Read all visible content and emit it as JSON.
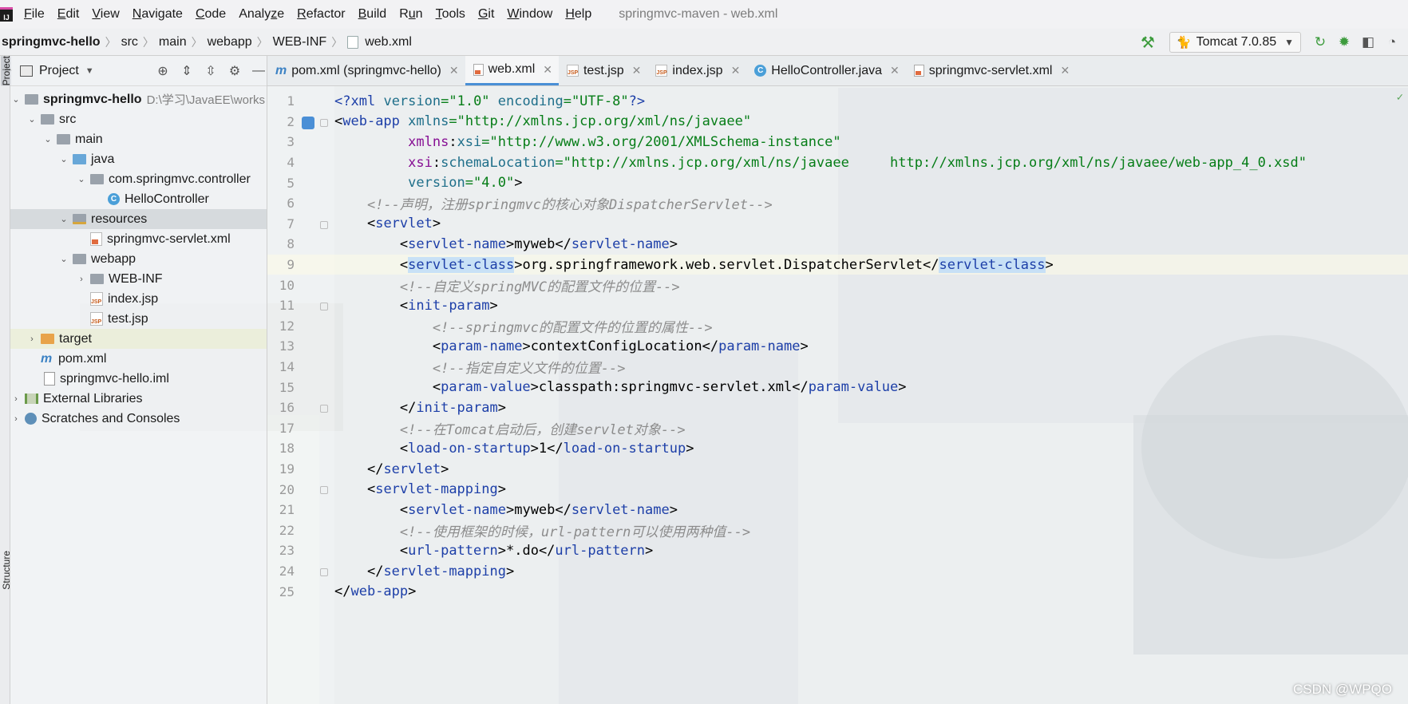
{
  "app": {
    "logo": "IJ"
  },
  "menu": [
    {
      "pre": "",
      "ul": "F",
      "post": "ile"
    },
    {
      "pre": "",
      "ul": "E",
      "post": "dit"
    },
    {
      "pre": "",
      "ul": "V",
      "post": "iew"
    },
    {
      "pre": "",
      "ul": "N",
      "post": "avigate"
    },
    {
      "pre": "",
      "ul": "C",
      "post": "ode"
    },
    {
      "pre": "Analy",
      "ul": "z",
      "post": "e"
    },
    {
      "pre": "",
      "ul": "R",
      "post": "efactor"
    },
    {
      "pre": "",
      "ul": "B",
      "post": "uild"
    },
    {
      "pre": "R",
      "ul": "u",
      "post": "n"
    },
    {
      "pre": "",
      "ul": "T",
      "post": "ools"
    },
    {
      "pre": "",
      "ul": "G",
      "post": "it"
    },
    {
      "pre": "",
      "ul": "W",
      "post": "indow"
    },
    {
      "pre": "",
      "ul": "H",
      "post": "elp"
    }
  ],
  "window_title": "springmvc-maven - web.xml",
  "breadcrumb": [
    "springmvc-hello",
    "src",
    "main",
    "webapp",
    "WEB-INF",
    "web.xml"
  ],
  "run_config": {
    "label": "Tomcat 7.0.85"
  },
  "project_panel": {
    "title": "Project",
    "root_path": "D:\\学习\\JavaEE\\works",
    "items": {
      "root": "springmvc-hello",
      "src": "src",
      "main": "main",
      "java": "java",
      "pkg": "com.springmvc.controller",
      "hello": "HelloController",
      "resources": "resources",
      "servlet_xml": "springmvc-servlet.xml",
      "webapp": "webapp",
      "webinf": "WEB-INF",
      "index": "index.jsp",
      "test": "test.jsp",
      "target": "target",
      "pom": "pom.xml",
      "iml": "springmvc-hello.iml",
      "libs": "External Libraries",
      "scratches": "Scratches and Consoles"
    }
  },
  "side_labels": {
    "project": "Project",
    "structure": "Structure"
  },
  "tabs": [
    {
      "label": "pom.xml (springmvc-hello)",
      "icon": "maven-icon",
      "active": false
    },
    {
      "label": "web.xml",
      "icon": "xml-file-icon",
      "active": true
    },
    {
      "label": "test.jsp",
      "icon": "jsp-file-icon",
      "active": false
    },
    {
      "label": "index.jsp",
      "icon": "jsp-file-icon",
      "active": false
    },
    {
      "label": "HelloController.java",
      "icon": "java-class-icon",
      "active": false
    },
    {
      "label": "springmvc-servlet.xml",
      "icon": "xml-file-icon",
      "active": false
    }
  ],
  "code_lines": [
    "<?xml version=\"1.0\" encoding=\"UTF-8\"?>",
    "<web-app xmlns=\"http://xmlns.jcp.org/xml/ns/javaee\"",
    "         xmlns:xsi=\"http://www.w3.org/2001/XMLSchema-instance\"",
    "         xsi:schemaLocation=\"http://xmlns.jcp.org/xml/ns/javaee     http://xmlns.jcp.org/xml/ns/javaee/web-app_4_0.xsd\"",
    "         version=\"4.0\">",
    "    <!--声明，注册springmvc的核心对象DispatcherServlet-->",
    "    <servlet>",
    "        <servlet-name>myweb</servlet-name>",
    "        <servlet-class>org.springframework.web.servlet.DispatcherServlet</servlet-class>",
    "        <!--自定义springMVC的配置文件的位置-->",
    "        <init-param>",
    "            <!--springmvc的配置文件的位置的属性-->",
    "            <param-name>contextConfigLocation</param-name>",
    "            <!--指定自定义文件的位置-->",
    "            <param-value>classpath:springmvc-servlet.xml</param-value>",
    "        </init-param>",
    "        <!--在Tomcat启动后，创建servlet对象-->",
    "        <load-on-startup>1</load-on-startup>",
    "    </servlet>",
    "    <servlet-mapping>",
    "        <servlet-name>myweb</servlet-name>",
    "        <!--使用框架的时候，url-pattern可以使用两种值-->",
    "        <url-pattern>*.do</url-pattern>",
    "    </servlet-mapping>",
    "</web-app>"
  ],
  "caret_line": 9,
  "watermark": "CSDN @WPQO",
  "colors": {
    "tag": "#1d3fa8",
    "attr": "#1f6f8a",
    "string": "#067d17",
    "comment": "#8c8c8c",
    "accent": "#4a8fd6"
  }
}
